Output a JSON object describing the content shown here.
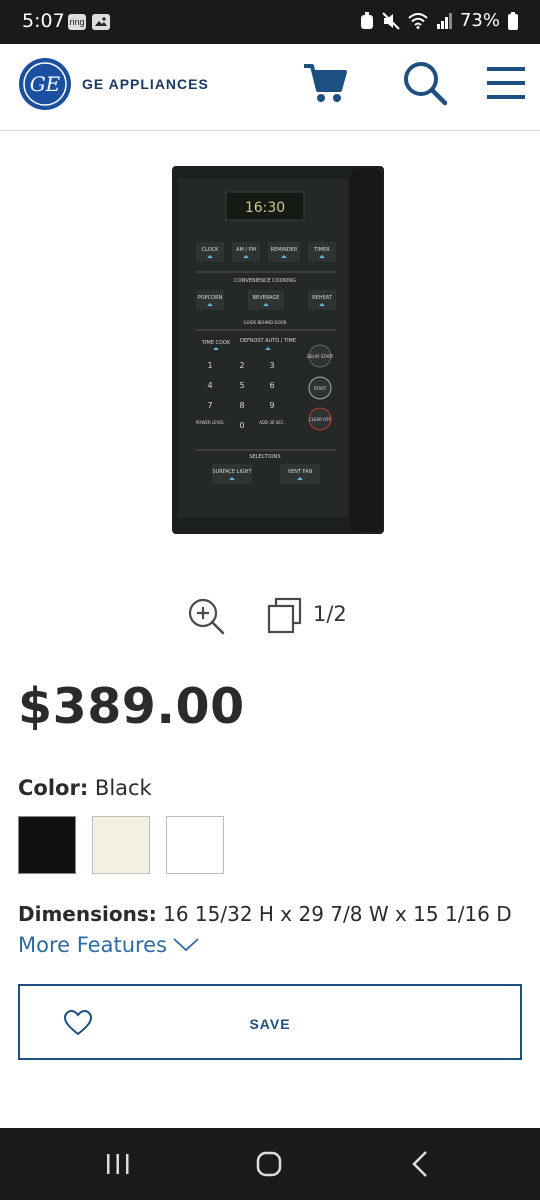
{
  "status_bar": {
    "time": "5:07",
    "notif_ring": "ring",
    "battery": "73%",
    "icons": [
      "alarm-icon",
      "mute-icon",
      "wifi-icon",
      "signal-icon",
      "battery-icon"
    ]
  },
  "header": {
    "brand": "GE APPLIANCES",
    "brand_color": "#1b3a63",
    "icons": [
      "cart-icon",
      "search-icon",
      "menu-icon"
    ]
  },
  "product_panel": {
    "display_time": "16:30",
    "row1": [
      "CLOCK",
      "AM / PM",
      "REMINDER",
      "TIMER"
    ],
    "section1": "CONVENIENCE COOKING",
    "row2": [
      "POPCORN",
      "BEVERAGE",
      "REHEAT"
    ],
    "guide_text": "GUIDE BEHIND DOOR",
    "time_cook": "TIME COOK",
    "defrost": "DEFROST AUTO / TIME",
    "delay_start": "DELAY START",
    "start": "START",
    "clear_off": "CLEAR OFF",
    "keys": [
      "1",
      "2",
      "3",
      "4",
      "5",
      "6",
      "7",
      "8",
      "9",
      "POWER LEVEL",
      "0",
      "ADD 30 SEC."
    ],
    "section2": "SELECTIONS",
    "surface_light": "SURFACE LIGHT",
    "vent_fan": "VENT FAN"
  },
  "gallery": {
    "counter": "1/2"
  },
  "price": "$389.00",
  "color": {
    "label": "Color:",
    "value": "Black",
    "swatches": [
      "#111111",
      "#f3f0e1",
      "#ffffff"
    ]
  },
  "dimensions": {
    "label": "Dimensions:",
    "value": "16 15/32 H x 29 7/8 W x 15 1/16 D"
  },
  "more_features": "More Features",
  "save_label": "SAVE",
  "accent": "#1d4f80"
}
